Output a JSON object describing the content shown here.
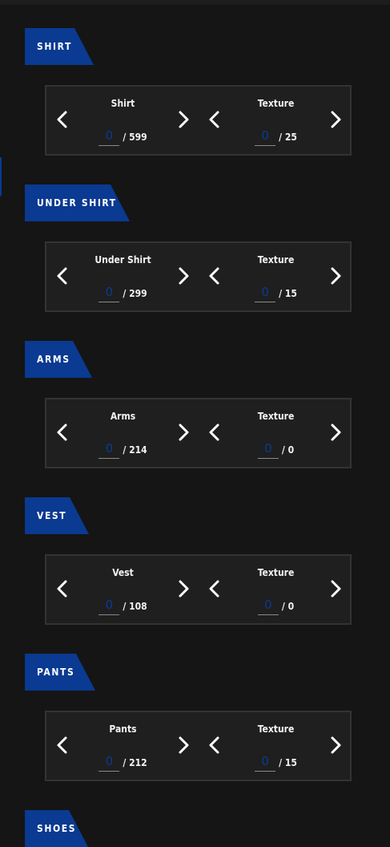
{
  "theme": {
    "accent": "#0a3a91",
    "background": "#151515",
    "panel": "#1f1f1f",
    "panel_border": "#333333"
  },
  "icons": {
    "prev": "chevron-left-icon",
    "next": "chevron-right-icon"
  },
  "sections": [
    {
      "title": "SHIRT",
      "item": {
        "label": "Shirt",
        "value": "0",
        "max": "/ 599"
      },
      "texture": {
        "label": "Texture",
        "value": "0",
        "max": "/ 25"
      }
    },
    {
      "title": "UNDER SHIRT",
      "item": {
        "label": "Under Shirt",
        "value": "0",
        "max": "/ 299"
      },
      "texture": {
        "label": "Texture",
        "value": "0",
        "max": "/ 15"
      }
    },
    {
      "title": "ARMS",
      "item": {
        "label": "Arms",
        "value": "0",
        "max": "/ 214"
      },
      "texture": {
        "label": "Texture",
        "value": "0",
        "max": "/ 0"
      }
    },
    {
      "title": "VEST",
      "item": {
        "label": "Vest",
        "value": "0",
        "max": "/ 108"
      },
      "texture": {
        "label": "Texture",
        "value": "0",
        "max": "/ 0"
      }
    },
    {
      "title": "PANTS",
      "item": {
        "label": "Pants",
        "value": "0",
        "max": "/ 212"
      },
      "texture": {
        "label": "Texture",
        "value": "0",
        "max": "/ 15"
      }
    },
    {
      "title": "SHOES"
    }
  ]
}
